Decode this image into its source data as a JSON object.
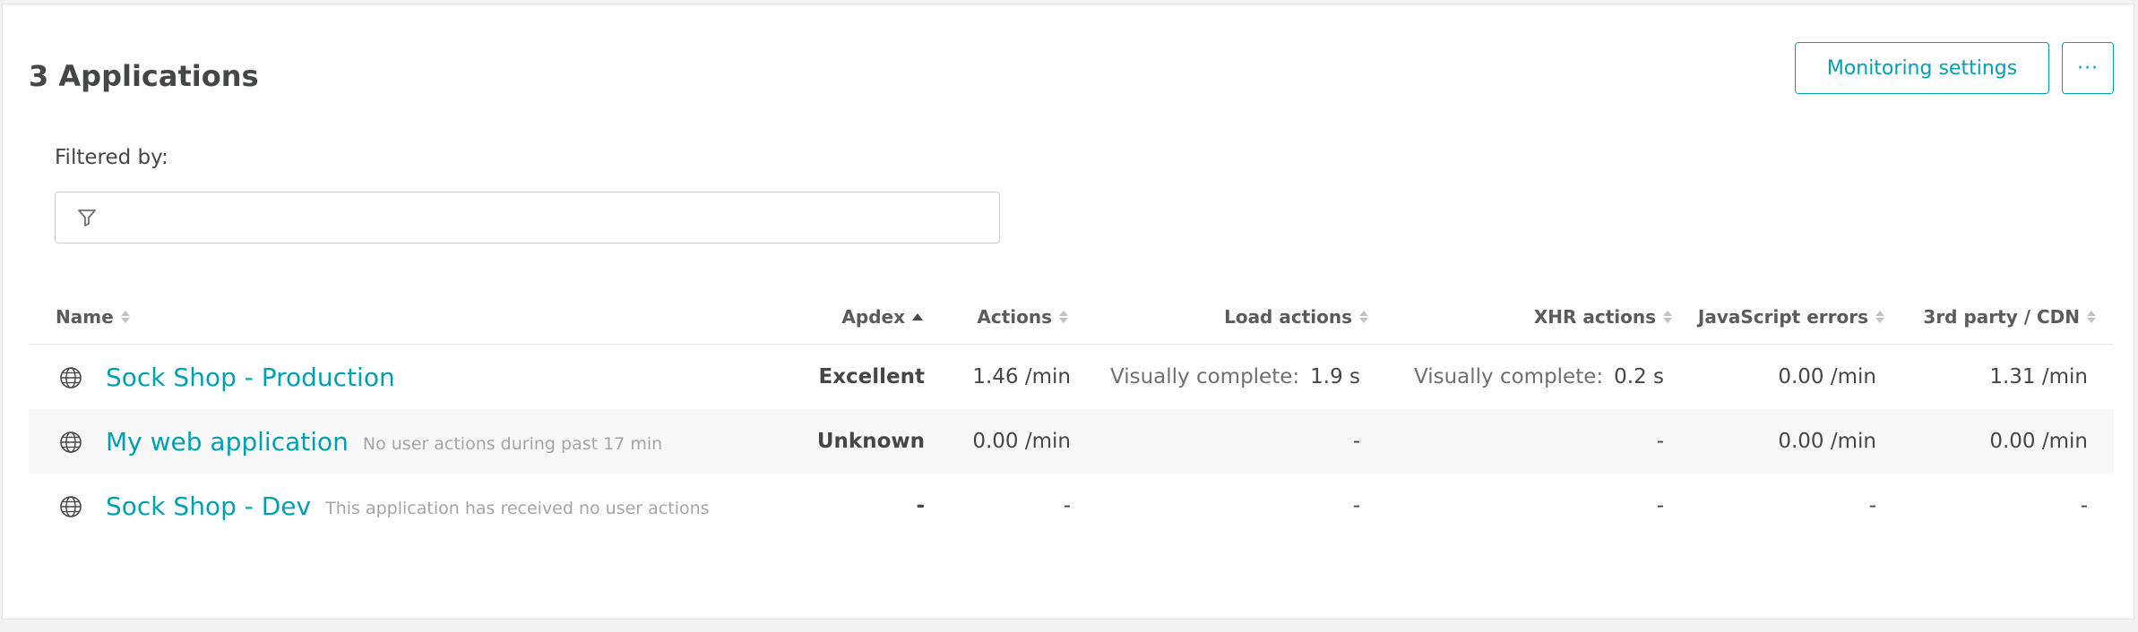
{
  "page": {
    "title": "3 Applications"
  },
  "toolbar": {
    "settings_label": "Monitoring settings",
    "more_label": "···"
  },
  "filter": {
    "label": "Filtered by:",
    "value": ""
  },
  "table": {
    "columns": [
      "Name",
      "Apdex",
      "Actions",
      "Load actions",
      "XHR actions",
      "JavaScript errors",
      "3rd party / CDN"
    ],
    "sorted_column": "Apdex",
    "rows": [
      {
        "name": "Sock Shop - Production",
        "hint": "",
        "apdex": "Excellent",
        "actions": "1.46 /min",
        "load_label": "Visually complete:",
        "load_value": "1.9 s",
        "xhr_label": "Visually complete:",
        "xhr_value": "0.2 s",
        "js_errors": "0.00 /min",
        "third_party": "1.31 /min"
      },
      {
        "name": "My web application",
        "hint": "No user actions during past 17 min",
        "apdex": "Unknown",
        "actions": "0.00 /min",
        "load_label": "",
        "load_value": "-",
        "xhr_label": "",
        "xhr_value": "-",
        "js_errors": "0.00 /min",
        "third_party": "0.00 /min"
      },
      {
        "name": "Sock Shop - Dev",
        "hint": "This application has received no user actions",
        "apdex": "-",
        "actions": "-",
        "load_label": "",
        "load_value": "-",
        "xhr_label": "",
        "xhr_value": "-",
        "js_errors": "-",
        "third_party": "-"
      }
    ]
  },
  "colors": {
    "accent": "#00a1b2",
    "text": "#454646",
    "muted": "#a5a5a5"
  },
  "icons": {
    "filter": "filter-icon",
    "row": "globe-icon",
    "sort": "sort-icon"
  }
}
